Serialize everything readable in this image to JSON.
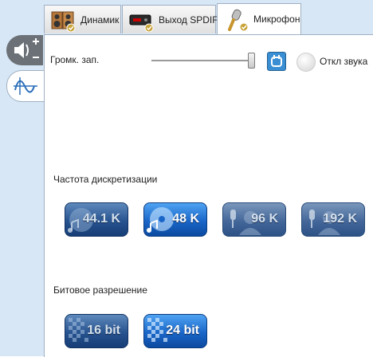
{
  "tabs": [
    {
      "label": "Динамик",
      "icon": "speakers-icon",
      "active": false
    },
    {
      "label": "Выход SPDIF",
      "icon": "spdif-device-icon",
      "active": false
    },
    {
      "label": "Микрофон",
      "icon": "microphone-icon",
      "active": true
    }
  ],
  "side": {
    "volume_icon": "speaker-plus-minus-icon",
    "effects_icon": "waveform-icon"
  },
  "recording": {
    "volume_label": "Громк. зап.",
    "volume_level_percent": 100,
    "mute_label": "Откл звука"
  },
  "sample_rate": {
    "label": "Частота дискретизации",
    "options": [
      {
        "label": "44.1 K",
        "state": "normal"
      },
      {
        "label": "48 K",
        "state": "selected"
      },
      {
        "label": "96 K",
        "state": "disabled"
      },
      {
        "label": "192 K",
        "state": "disabled"
      }
    ]
  },
  "bit_depth": {
    "label": "Битовое разрешение",
    "options": [
      {
        "label": "16 bit",
        "state": "normal"
      },
      {
        "label": "24 bit",
        "state": "selected"
      }
    ]
  },
  "colors": {
    "rail": "#d8e7f6",
    "accent": "#3a8fd4",
    "button_selected": "#1a66c8",
    "button_normal": "#27538f"
  }
}
